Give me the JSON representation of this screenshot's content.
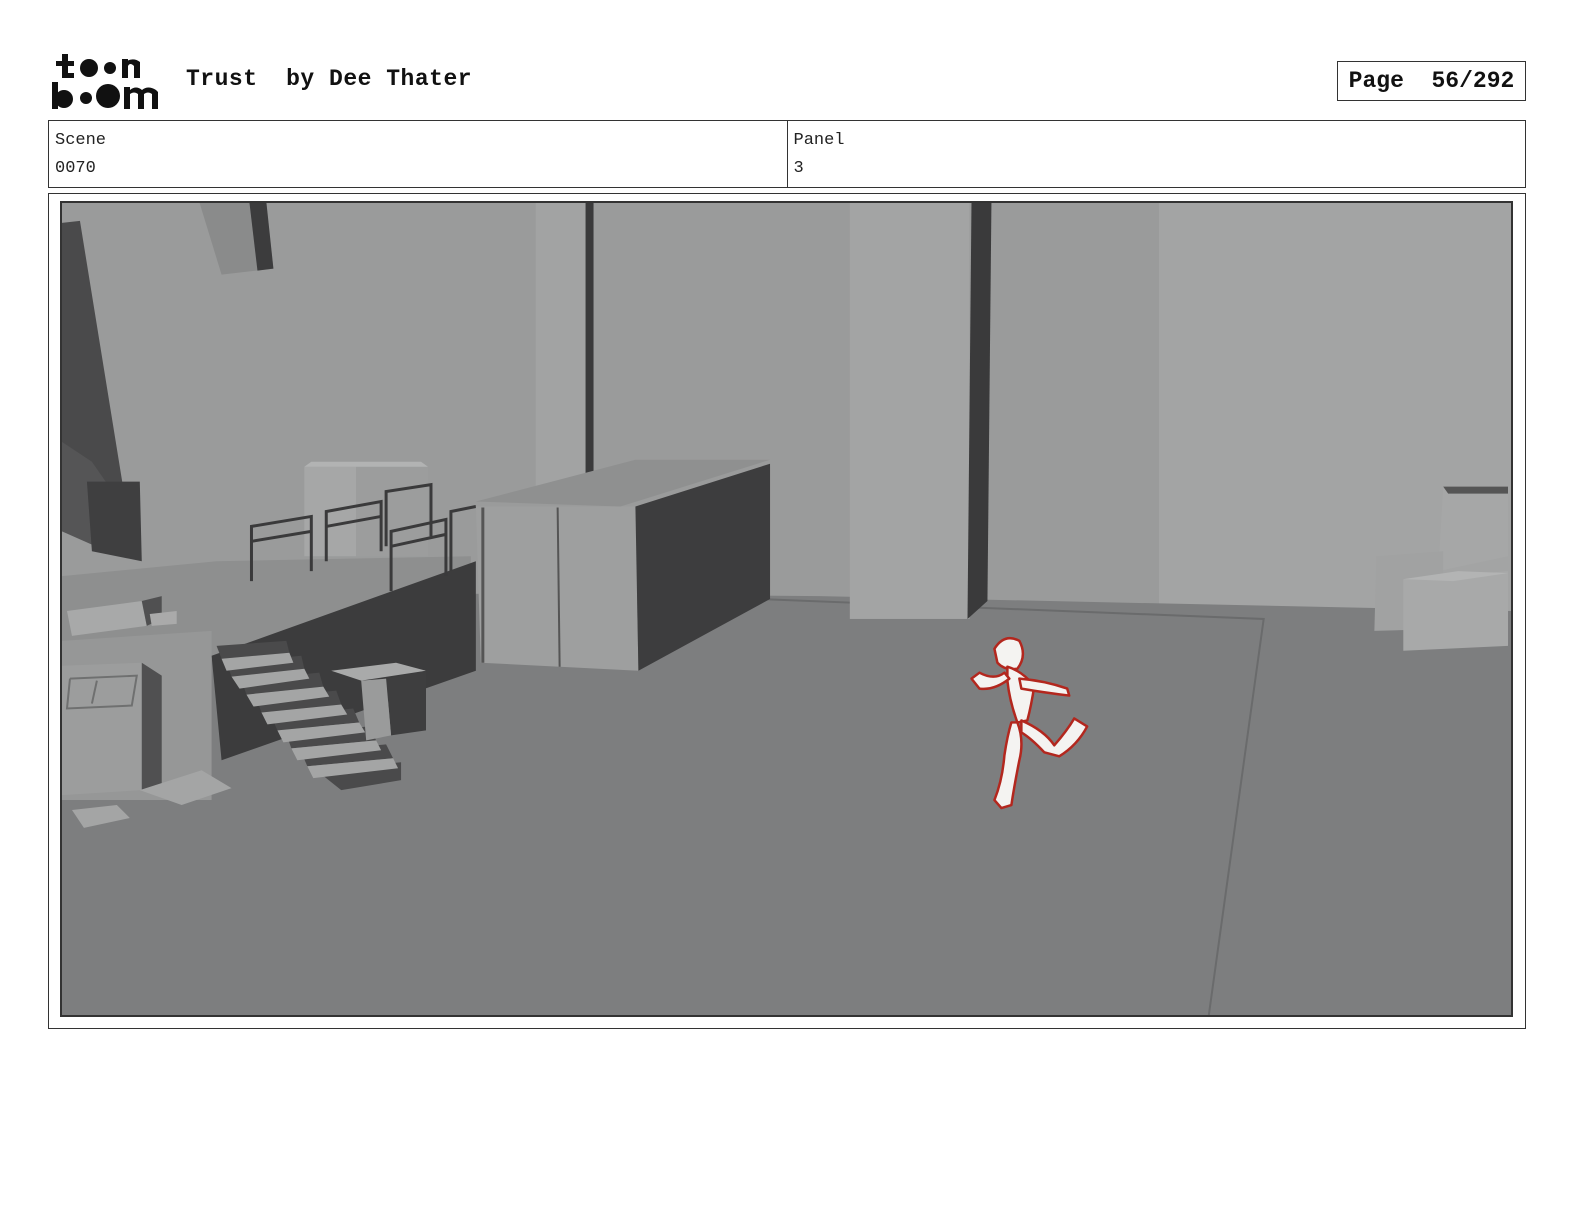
{
  "header": {
    "logo_line1": "toon",
    "logo_line2": "boom",
    "title": "Trust  by Dee Thater",
    "page_label": "Page  56/292"
  },
  "info": {
    "scene_label": "Scene",
    "scene_value": "0070",
    "panel_label": "Panel",
    "panel_value": "3"
  },
  "colors": {
    "ink": "#111111",
    "wall": "#9a9b9b",
    "floor": "#7d7e7f",
    "shadow": "#3c3c3d",
    "sketch_line": "#b3271e"
  }
}
